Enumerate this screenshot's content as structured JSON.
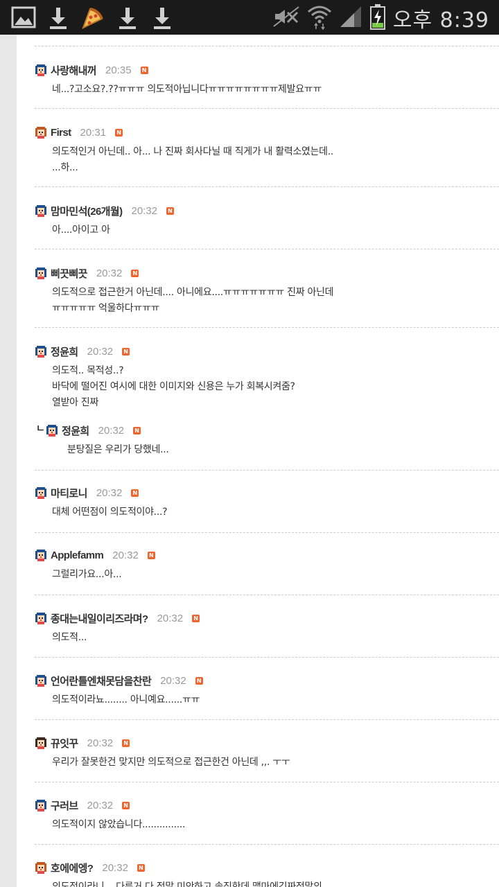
{
  "status_bar": {
    "time": "오후 8:39",
    "icons": [
      "gallery-icon",
      "download-icon",
      "pizza-icon",
      "download-icon",
      "download-icon",
      "mute-icon",
      "wifi-icon",
      "signal-icon",
      "battery-charging-icon"
    ]
  },
  "comments": [
    {
      "nick": "사랑해내꺼",
      "time": "20:35",
      "body": "네...?고소요?.??ㅠㅠㅠ 의도적아닙니다ㅠㅠㅠㅠㅠㅠㅠㅠ제발요ㅠㅠ",
      "avatar": "girl-blue"
    },
    {
      "nick": "First",
      "time": "20:31",
      "body": "의도적인거 아닌데.. 아... 나 진짜 회사다닐 때 직게가 내 활력소였는데..\n...하...",
      "avatar": "girl-orange"
    },
    {
      "nick": "맘마민석(26개월)",
      "time": "20:32",
      "body": "아....아이고 아",
      "avatar": "girl-blue"
    },
    {
      "nick": "삐끗삐끗",
      "time": "20:32",
      "body": "의도적으로 접근한거 아닌데.... 아니에요....ㅠㅠㅠㅠㅠㅠㅠ 진짜 아닌데\nㅠㅠㅠㅠㅠ 억울하다ㅠㅠㅠ",
      "avatar": "girl-blue"
    },
    {
      "nick": "정윤희",
      "time": "20:32",
      "body": "의도적.. 목적성..?\n바닥에 떨어진 여시에 대한 이미지와 신용은 누가 회복시켜줌?\n열받아 진짜",
      "avatar": "girl-blue"
    },
    {
      "nick": "정윤희",
      "time": "20:32",
      "body": "분탕질은 우리가 당했네...",
      "avatar": "girl-blue",
      "reply": true,
      "reply_mark": "ㄴ"
    },
    {
      "nick": "마티로니",
      "time": "20:32",
      "body": "대체 어떤점이 의도적이야...?",
      "avatar": "girl-blue"
    },
    {
      "nick": "Applefamm",
      "time": "20:32",
      "body": "그럴리가요...아...",
      "avatar": "girl-blue"
    },
    {
      "nick": "종대는내일이리즈라며?",
      "time": "20:32",
      "body": "의도적...",
      "avatar": "girl-blue"
    },
    {
      "nick": "언어란틀엔채못담을찬란",
      "time": "20:32",
      "body": "의도적이라뇨........ 아니예요......ㅠㅠ",
      "avatar": "girl-blue"
    },
    {
      "nick": "뀨잇꾸",
      "time": "20:32",
      "body": "우리가 잘못한건 맞지만 의도적으로 접근한건 아닌데 ,,. ㅜㅜ",
      "avatar": "girl-dark"
    },
    {
      "nick": "구러브",
      "time": "20:32",
      "body": "의도적이지 않았습니다...............",
      "avatar": "girl-blue"
    },
    {
      "nick": "호에에엥?",
      "time": "20:32",
      "body": "의도적이라니... 다른거 다 정말 미안하고 솔직한데 맴마에긴짜정말의",
      "avatar": "girl-orange"
    }
  ],
  "badge_letter": "N",
  "colors": {
    "badge": "#f0642d",
    "divider": "#cccccc",
    "nick": "#333333",
    "time": "#9a9a9a"
  }
}
